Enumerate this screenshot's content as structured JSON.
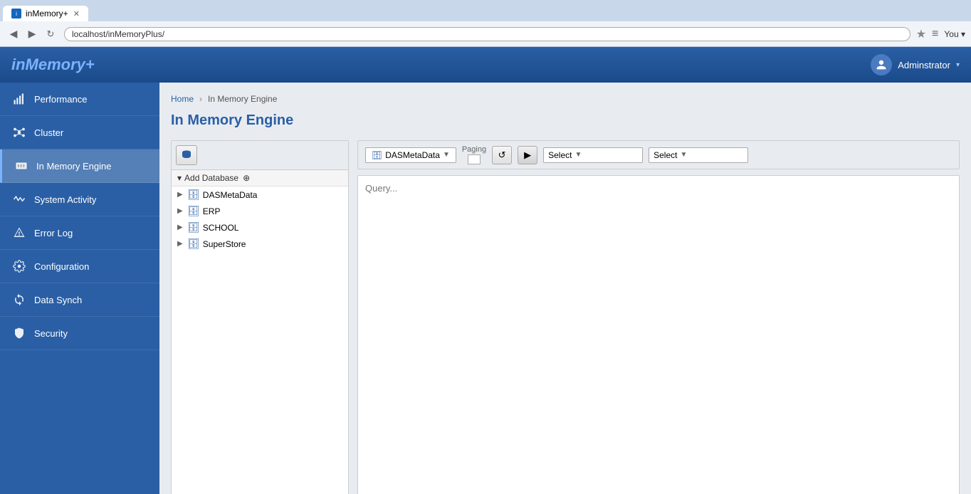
{
  "browser": {
    "tab_label": "inMemory+",
    "url": "localhost/inMemoryPlus/",
    "back_btn": "◀",
    "forward_btn": "▶",
    "reload_btn": "↻",
    "bookmark_icon": "★",
    "menu_icon": "≡",
    "user_label": "You ▾"
  },
  "header": {
    "logo": "inMemory+",
    "user_label": "Adminstrator",
    "dropdown_arrow": "▾"
  },
  "breadcrumb": {
    "home": "Home",
    "separator": "›",
    "current": "In Memory Engine"
  },
  "page_title": "In Memory Engine",
  "sidebar": {
    "items": [
      {
        "id": "performance",
        "label": "Performance",
        "icon": "perf"
      },
      {
        "id": "cluster",
        "label": "Cluster",
        "icon": "cluster"
      },
      {
        "id": "in-memory-engine",
        "label": "In Memory Engine",
        "icon": "memory",
        "active": true
      },
      {
        "id": "system-activity",
        "label": "System Activity",
        "icon": "activity"
      },
      {
        "id": "error-log",
        "label": "Error Log",
        "icon": "error"
      },
      {
        "id": "configuration",
        "label": "Configuration",
        "icon": "config"
      },
      {
        "id": "data-synch",
        "label": "Data Synch",
        "icon": "sync"
      },
      {
        "id": "security",
        "label": "Security",
        "icon": "security"
      }
    ]
  },
  "tree": {
    "add_database_label": "Add Database",
    "databases": [
      {
        "name": "DASMetaData"
      },
      {
        "name": "ERP"
      },
      {
        "name": "SCHOOL"
      },
      {
        "name": "SuperStore"
      }
    ]
  },
  "query_toolbar": {
    "selected_db": "DASMetaData",
    "paging_label": "Paging",
    "select1_label": "Select",
    "select2_label": "Select"
  },
  "query_area": {
    "placeholder": "Query..."
  }
}
